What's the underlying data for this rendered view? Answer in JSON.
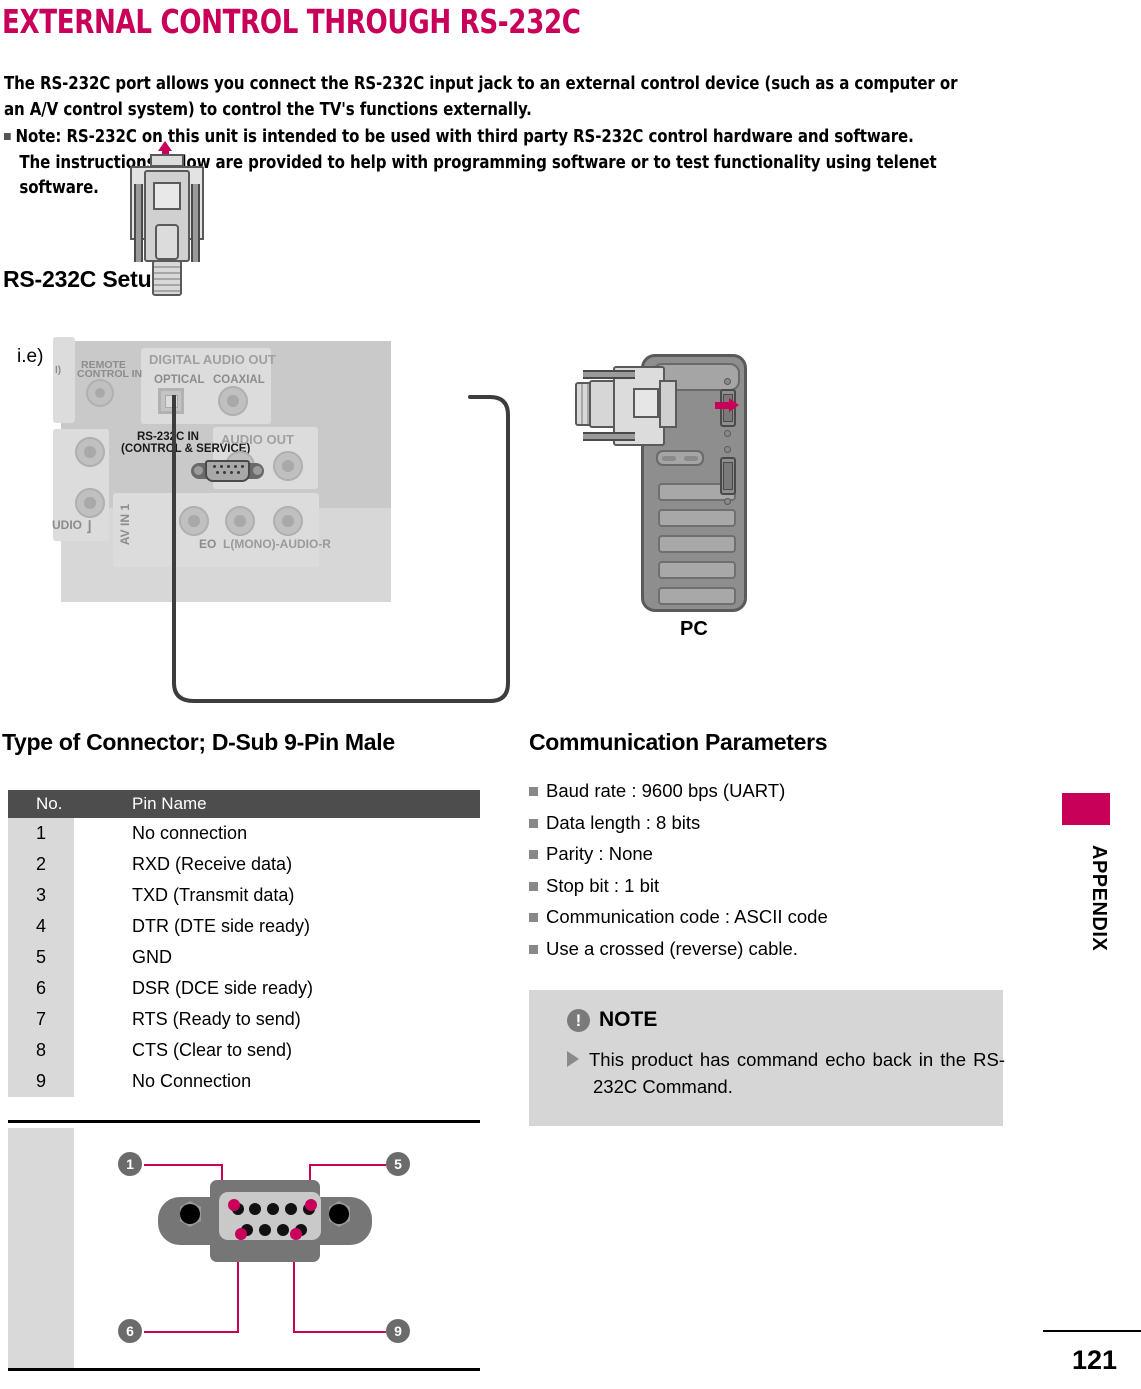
{
  "page": {
    "title": "EXTERNAL CONTROL THROUGH RS-232C",
    "number": "121",
    "section_tab": "APPENDIX",
    "accent_color": "#c8005a"
  },
  "intro": {
    "paragraph": "The RS-232C port allows you connect the RS-232C input jack to an external control device (such as a computer or an A/V control system) to control the TV's functions externally.",
    "note_line": "Note: RS-232C on this unit is intended to be used with third party RS-232C control hardware and software.",
    "note_cont": "The instructions below are provided to help with programming software or to test functionality using telenet software."
  },
  "setup": {
    "heading": "RS-232C Setup",
    "ie_label": "i.e)",
    "pc_caption": "PC",
    "tv_panel_labels": {
      "hdmi_partial": "I)",
      "remote_line1": "REMOTE",
      "remote_line2": "CONTROL IN",
      "digital_audio_out": "DIGITAL AUDIO OUT",
      "optical": "OPTICAL",
      "coaxial": "COAXIAL",
      "rs232c_line1": "RS-232C IN",
      "rs232c_line2": "(CONTROL & SERVICE)",
      "audio_out": "AUDIO OUT",
      "av_in_1": "AV IN 1",
      "video_partial": "EO",
      "audio_lr": "L(MONO)-AUDIO-R",
      "r_label": "R",
      "audio_partial": "UDIO"
    }
  },
  "connector": {
    "heading": "Type of Connector; D-Sub 9-Pin Male",
    "columns": [
      "No.",
      "Pin Name"
    ],
    "rows": [
      {
        "no": "1",
        "name": "No connection"
      },
      {
        "no": "2",
        "name": "RXD (Receive data)"
      },
      {
        "no": "3",
        "name": "TXD (Transmit data)"
      },
      {
        "no": "4",
        "name": "DTR (DTE side ready)"
      },
      {
        "no": "5",
        "name": "GND"
      },
      {
        "no": "6",
        "name": "DSR (DCE side ready)"
      },
      {
        "no": "7",
        "name": "RTS (Ready to send)"
      },
      {
        "no": "8",
        "name": "CTS (Clear to send)"
      },
      {
        "no": "9",
        "name": "No Connection"
      }
    ],
    "pinout_callouts": [
      "1",
      "5",
      "6",
      "9"
    ]
  },
  "communication": {
    "heading": "Communication Parameters",
    "items": [
      "Baud rate : 9600 bps (UART)",
      "Data length : 8 bits",
      "Parity : None",
      "Stop bit : 1 bit",
      "Communication code : ASCII code",
      "Use a crossed (reverse) cable."
    ]
  },
  "note": {
    "title": "NOTE",
    "icon": "!",
    "body": "This product has command echo back in the RS-232C Command."
  }
}
